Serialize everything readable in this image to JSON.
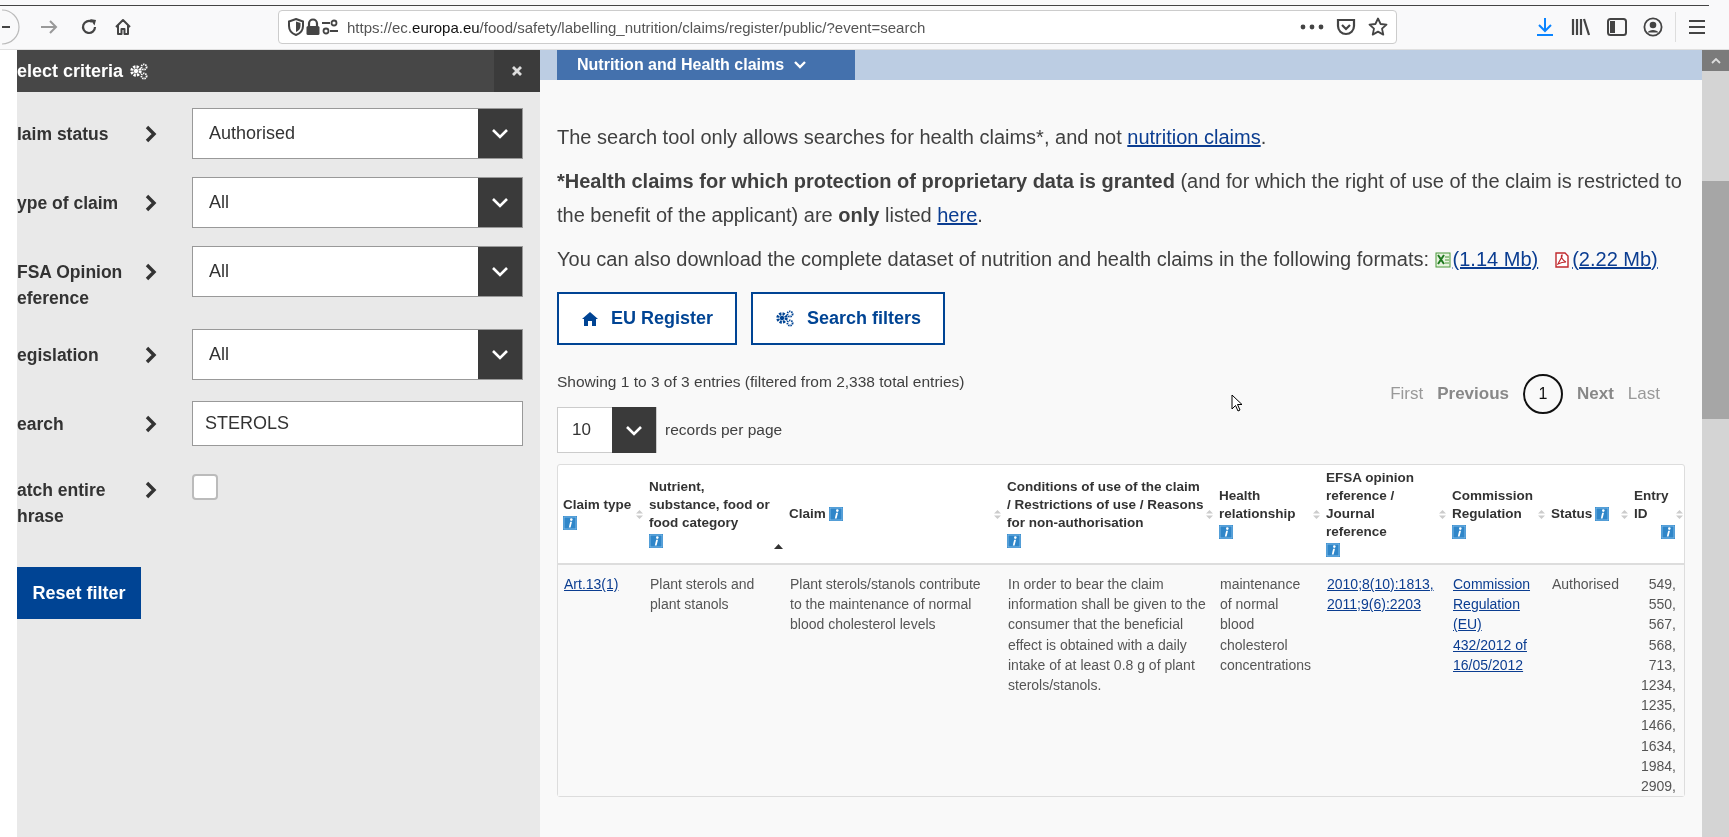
{
  "browser": {
    "url": "https://ec.**europa.eu**/food/safety/labelling_nutrition/claims/register/public/?event=search"
  },
  "panel": {
    "title": "elect criteria",
    "reset_button": "Reset filter",
    "filters": [
      {
        "kind": "select",
        "label": "laim status",
        "value": "Authorised"
      },
      {
        "kind": "select",
        "label": "ype of claim",
        "value": "All"
      },
      {
        "kind": "select",
        "label": "FSA Opinion eference",
        "value": "All"
      },
      {
        "kind": "select",
        "label": "egislation",
        "value": "All"
      },
      {
        "kind": "text",
        "label": "earch",
        "value": "STEROLS"
      },
      {
        "kind": "checkbox",
        "label": "atch entire hrase",
        "checked": false
      }
    ]
  },
  "main": {
    "tab": "Nutrition and Health claims",
    "paragraphs": [
      [
        {
          "kind": "text",
          "text": "The search tool only allows searches for health claims*, and not "
        },
        {
          "kind": "link",
          "text": "nutrition claims"
        },
        {
          "kind": "text",
          "text": "."
        }
      ],
      [
        {
          "kind": "bold",
          "text": "*Health claims for which protection of proprietary data is granted"
        },
        {
          "kind": "text",
          "text": " (and for which the right of use of the claim is restricted to the benefit of the applicant) are "
        },
        {
          "kind": "bold",
          "text": "only"
        },
        {
          "kind": "text",
          "text": " listed "
        },
        {
          "kind": "link",
          "text": "here"
        },
        {
          "kind": "text",
          "text": "."
        }
      ],
      [
        {
          "kind": "text",
          "text": "You can also download the complete dataset of nutrition and health claims in the following formats: "
        },
        {
          "kind": "xls_link",
          "text": "(1.14 Mb)"
        },
        {
          "kind": "pdf_link",
          "text": "(2.22 Mb)"
        }
      ]
    ],
    "buttons": [
      {
        "kind": "home",
        "label": "EU Register"
      },
      {
        "kind": "filters",
        "label": "Search filters"
      }
    ],
    "info": "Showing 1 to 3 of 3 entries (filtered from 2,338 total entries)",
    "pagination": [
      {
        "kind": "edge",
        "label": "First",
        "selected": false
      },
      {
        "kind": "step",
        "label": "Previous",
        "selected": false
      },
      {
        "kind": "page",
        "label": "1",
        "selected": true
      },
      {
        "kind": "step",
        "label": "Next",
        "selected": false
      },
      {
        "kind": "edge",
        "label": "Last",
        "selected": false
      }
    ],
    "page_length": {
      "value": "10",
      "label": "records per page"
    },
    "table": {
      "columns": [
        {
          "label": "Claim type",
          "info": true,
          "sorted": false
        },
        {
          "label": "Nutrient, substance, food or food category",
          "info": true,
          "sorted": true
        },
        {
          "label": "Claim",
          "info": true,
          "sorted": false
        },
        {
          "label": "Conditions of use of the claim / Restrictions of use / Reasons for non-authorisation",
          "info": true,
          "sorted": false
        },
        {
          "label": "Health relationship",
          "info": true,
          "sorted": false
        },
        {
          "label": "EFSA opinion reference / Journal reference",
          "info": true,
          "sorted": false
        },
        {
          "label": "Commission Regulation",
          "info": true,
          "sorted": false
        },
        {
          "label": "Status",
          "info": true,
          "sorted": false
        },
        {
          "label": "Entry ID",
          "info": true,
          "sorted": false
        }
      ],
      "rows": [
        [
          {
            "kind": "link",
            "text": "Art.13(1)"
          },
          {
            "kind": "text",
            "text": "Plant sterols and plant stanols"
          },
          {
            "kind": "text",
            "text": "Plant sterols/stanols contribute to the maintenance of normal blood cholesterol levels"
          },
          {
            "kind": "text",
            "text": "In order to bear the claim information shall be given to the consumer that the beneficial effect is obtained with a daily intake of at least 0.8 g of plant sterols/stanols."
          },
          {
            "kind": "text",
            "text": "maintenance of normal blood cholesterol concentrations"
          },
          {
            "kind": "link",
            "text": "2010;8(10):1813, 2011;9(6):2203"
          },
          {
            "kind": "link",
            "text": "Commission Regulation (EU) 432/2012 of 16/05/2012"
          },
          {
            "kind": "text",
            "text": "Authorised"
          },
          {
            "kind": "number",
            "text": "549, 550, 567, 568, 713, 1234, 1235, 1466, 1634, 1984, 2909,"
          }
        ]
      ]
    }
  }
}
